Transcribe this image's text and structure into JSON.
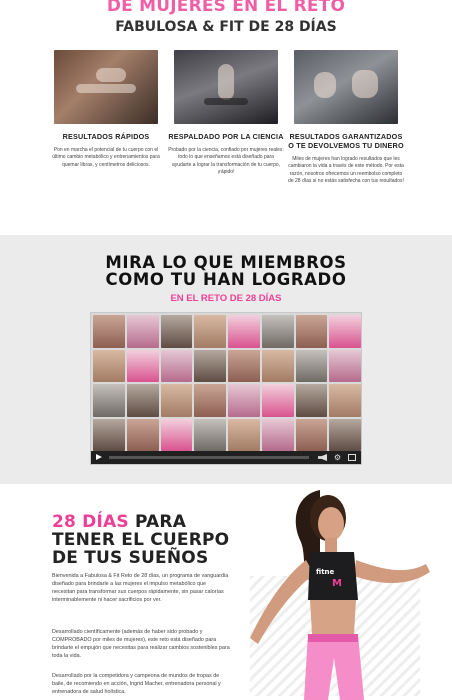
{
  "hero": {
    "title_pink": "DE MUJERES EN EL RETO",
    "subtitle": "FABULOSA & FIT DE 28 DÍAS"
  },
  "benefits": [
    {
      "title": "RESULTADOS RÁPIDOS",
      "text": "Pon en marcha el potencial de tu cuerpo con el último cambio metabólico y entrenamientos para quemar libras, y centímetros deliciosos."
    },
    {
      "title": "RESPALDADO POR LA CIENCIA",
      "text": "Probado por la ciencia, confiado por mujeres reales: todo lo que enseñamos está diseñado para ayudarte a lograr la transformación de tu cuerpo, ¡rápido!"
    },
    {
      "title": "RESULTADOS GARANTIZADOS O TE DEVOLVEMOS TU DINERO",
      "text": "Miles de mujeres han logrado resultados que les cambiaron la vida a través de este método. Por esta razón, nosotros ofrecemos un reembolso completo de 28 días si no estás satisfecha con tus resultados!"
    }
  ],
  "members": {
    "title_line1": "MIRA LO QUE MIEMBROS",
    "title_line2": "COMO TU HAN LOGRADO",
    "subtitle": "EN EL RETO DE 28 DÍAS"
  },
  "video": {
    "play_icon": "play-icon",
    "volume_icon": "volume-icon",
    "settings_icon": "gear-icon",
    "fullscreen_icon": "fullscreen-icon"
  },
  "promo": {
    "title_pink": "28 DÍAS",
    "title_rest1": " PARA",
    "title_line2": "TENER EL CUERPO",
    "title_line3": "DE TUS SUEÑOS",
    "p1": "Bienvenida a Fabulosa & Fit Reto de 28 días, un programa de vanguardia diseñado para brindarle a las mujeres el impulso metabólico que necesitan para transformar sus cuerpos rápidamente, sin pasar calorías interminablemente ni hacer sacrificios por ver.",
    "p2": "Desarrollado científicamente (además de haber sido probado y COMPROBADO por miles de mujeres), este reto está diseñado para brindarte el empujón que necesitas para realizar cambios sostenibles para toda la vida.",
    "p3": "Desarrollado por la competidora y campeona de mundos de tropas de baile, de recomiendo en acción, Ingrid Macher, entrenadora personal y entrenadora de salud holística."
  },
  "colors": {
    "accent_pink": "#ee3f96",
    "members_bg": "#ebebeb"
  }
}
